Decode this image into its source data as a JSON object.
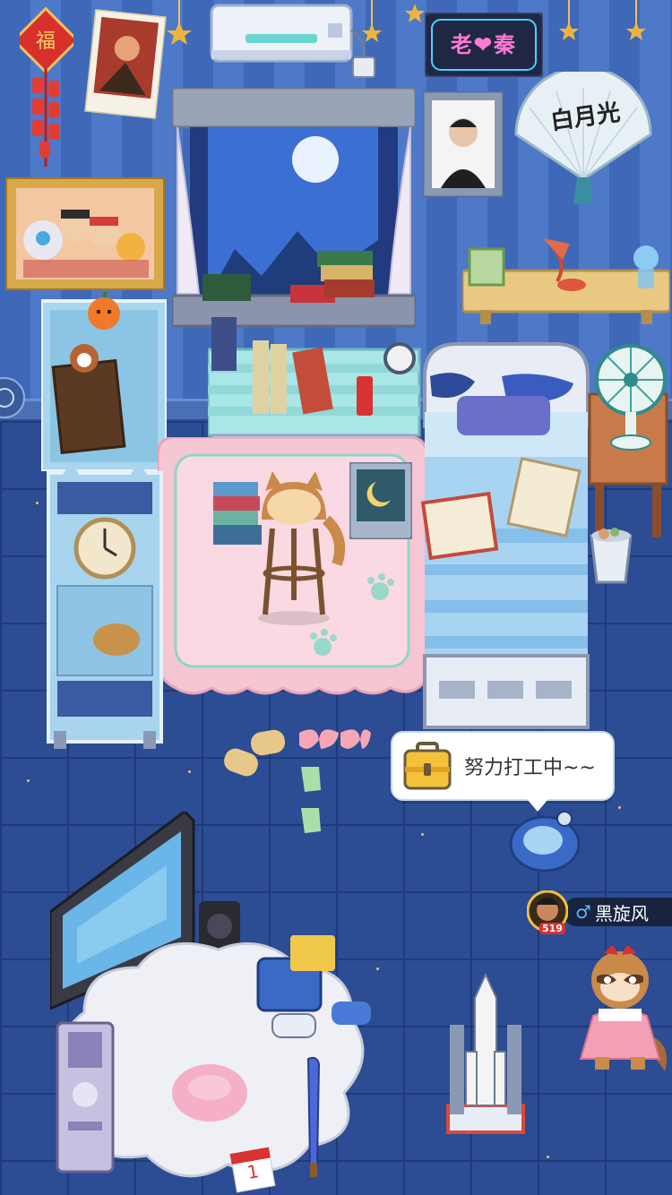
{
  "room": {
    "neon_sign": "老❤秦",
    "fan_text": "白月光",
    "calendar_day": "1"
  },
  "status_bubble": {
    "icon": "briefcase-icon",
    "text": "努力打工中~~"
  },
  "player": {
    "gender_symbol": "♂",
    "name": "黑旋风",
    "level": "519"
  },
  "side_button": {
    "icon": "compass-icon"
  },
  "colors": {
    "wall": "#4d79c8",
    "floor": "#2c4c93",
    "rug": "#f6c6d3",
    "bubble_bg": "#ffffff"
  }
}
